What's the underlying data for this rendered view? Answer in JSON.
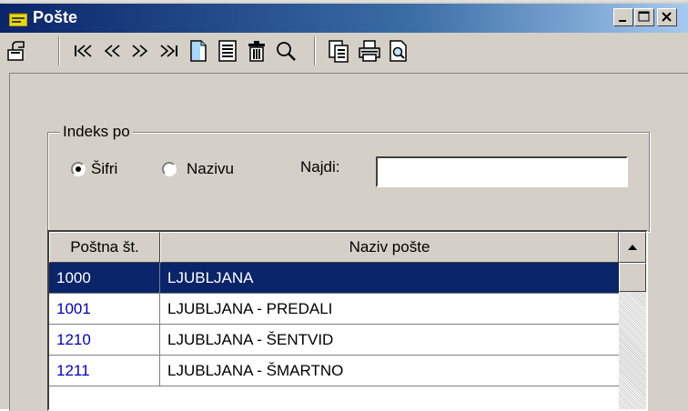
{
  "window": {
    "title": "Pošte",
    "accent": "#0a246a"
  },
  "title_buttons": [
    "minimize-icon",
    "maximize-icon",
    "close-icon"
  ],
  "toolbar": {
    "icons": [
      "exit-icon",
      "first-record-icon",
      "previous-record-icon",
      "next-record-icon",
      "last-record-icon",
      "new-record-icon",
      "edit-record-icon",
      "delete-record-icon",
      "search-icon",
      "copy-icon",
      "print-icon",
      "print-preview-icon"
    ]
  },
  "index_group": {
    "title": "Indeks po",
    "options": [
      {
        "label": "Šifri",
        "selected": true
      },
      {
        "label": "Nazivu",
        "selected": false
      }
    ],
    "find_label": "Najdi:",
    "find_value": ""
  },
  "grid": {
    "columns": [
      "Poštna št.",
      "Naziv pošte"
    ],
    "rows": [
      {
        "code": "1000",
        "name": "LJUBLJANA",
        "selected": true
      },
      {
        "code": "1001",
        "name": "LJUBLJANA - PREDALI",
        "selected": false
      },
      {
        "code": "1210",
        "name": "LJUBLJANA - ŠENTVID",
        "selected": false
      },
      {
        "code": "1211",
        "name": "LJUBLJANA - ŠMARTNO",
        "selected": false
      }
    ]
  }
}
